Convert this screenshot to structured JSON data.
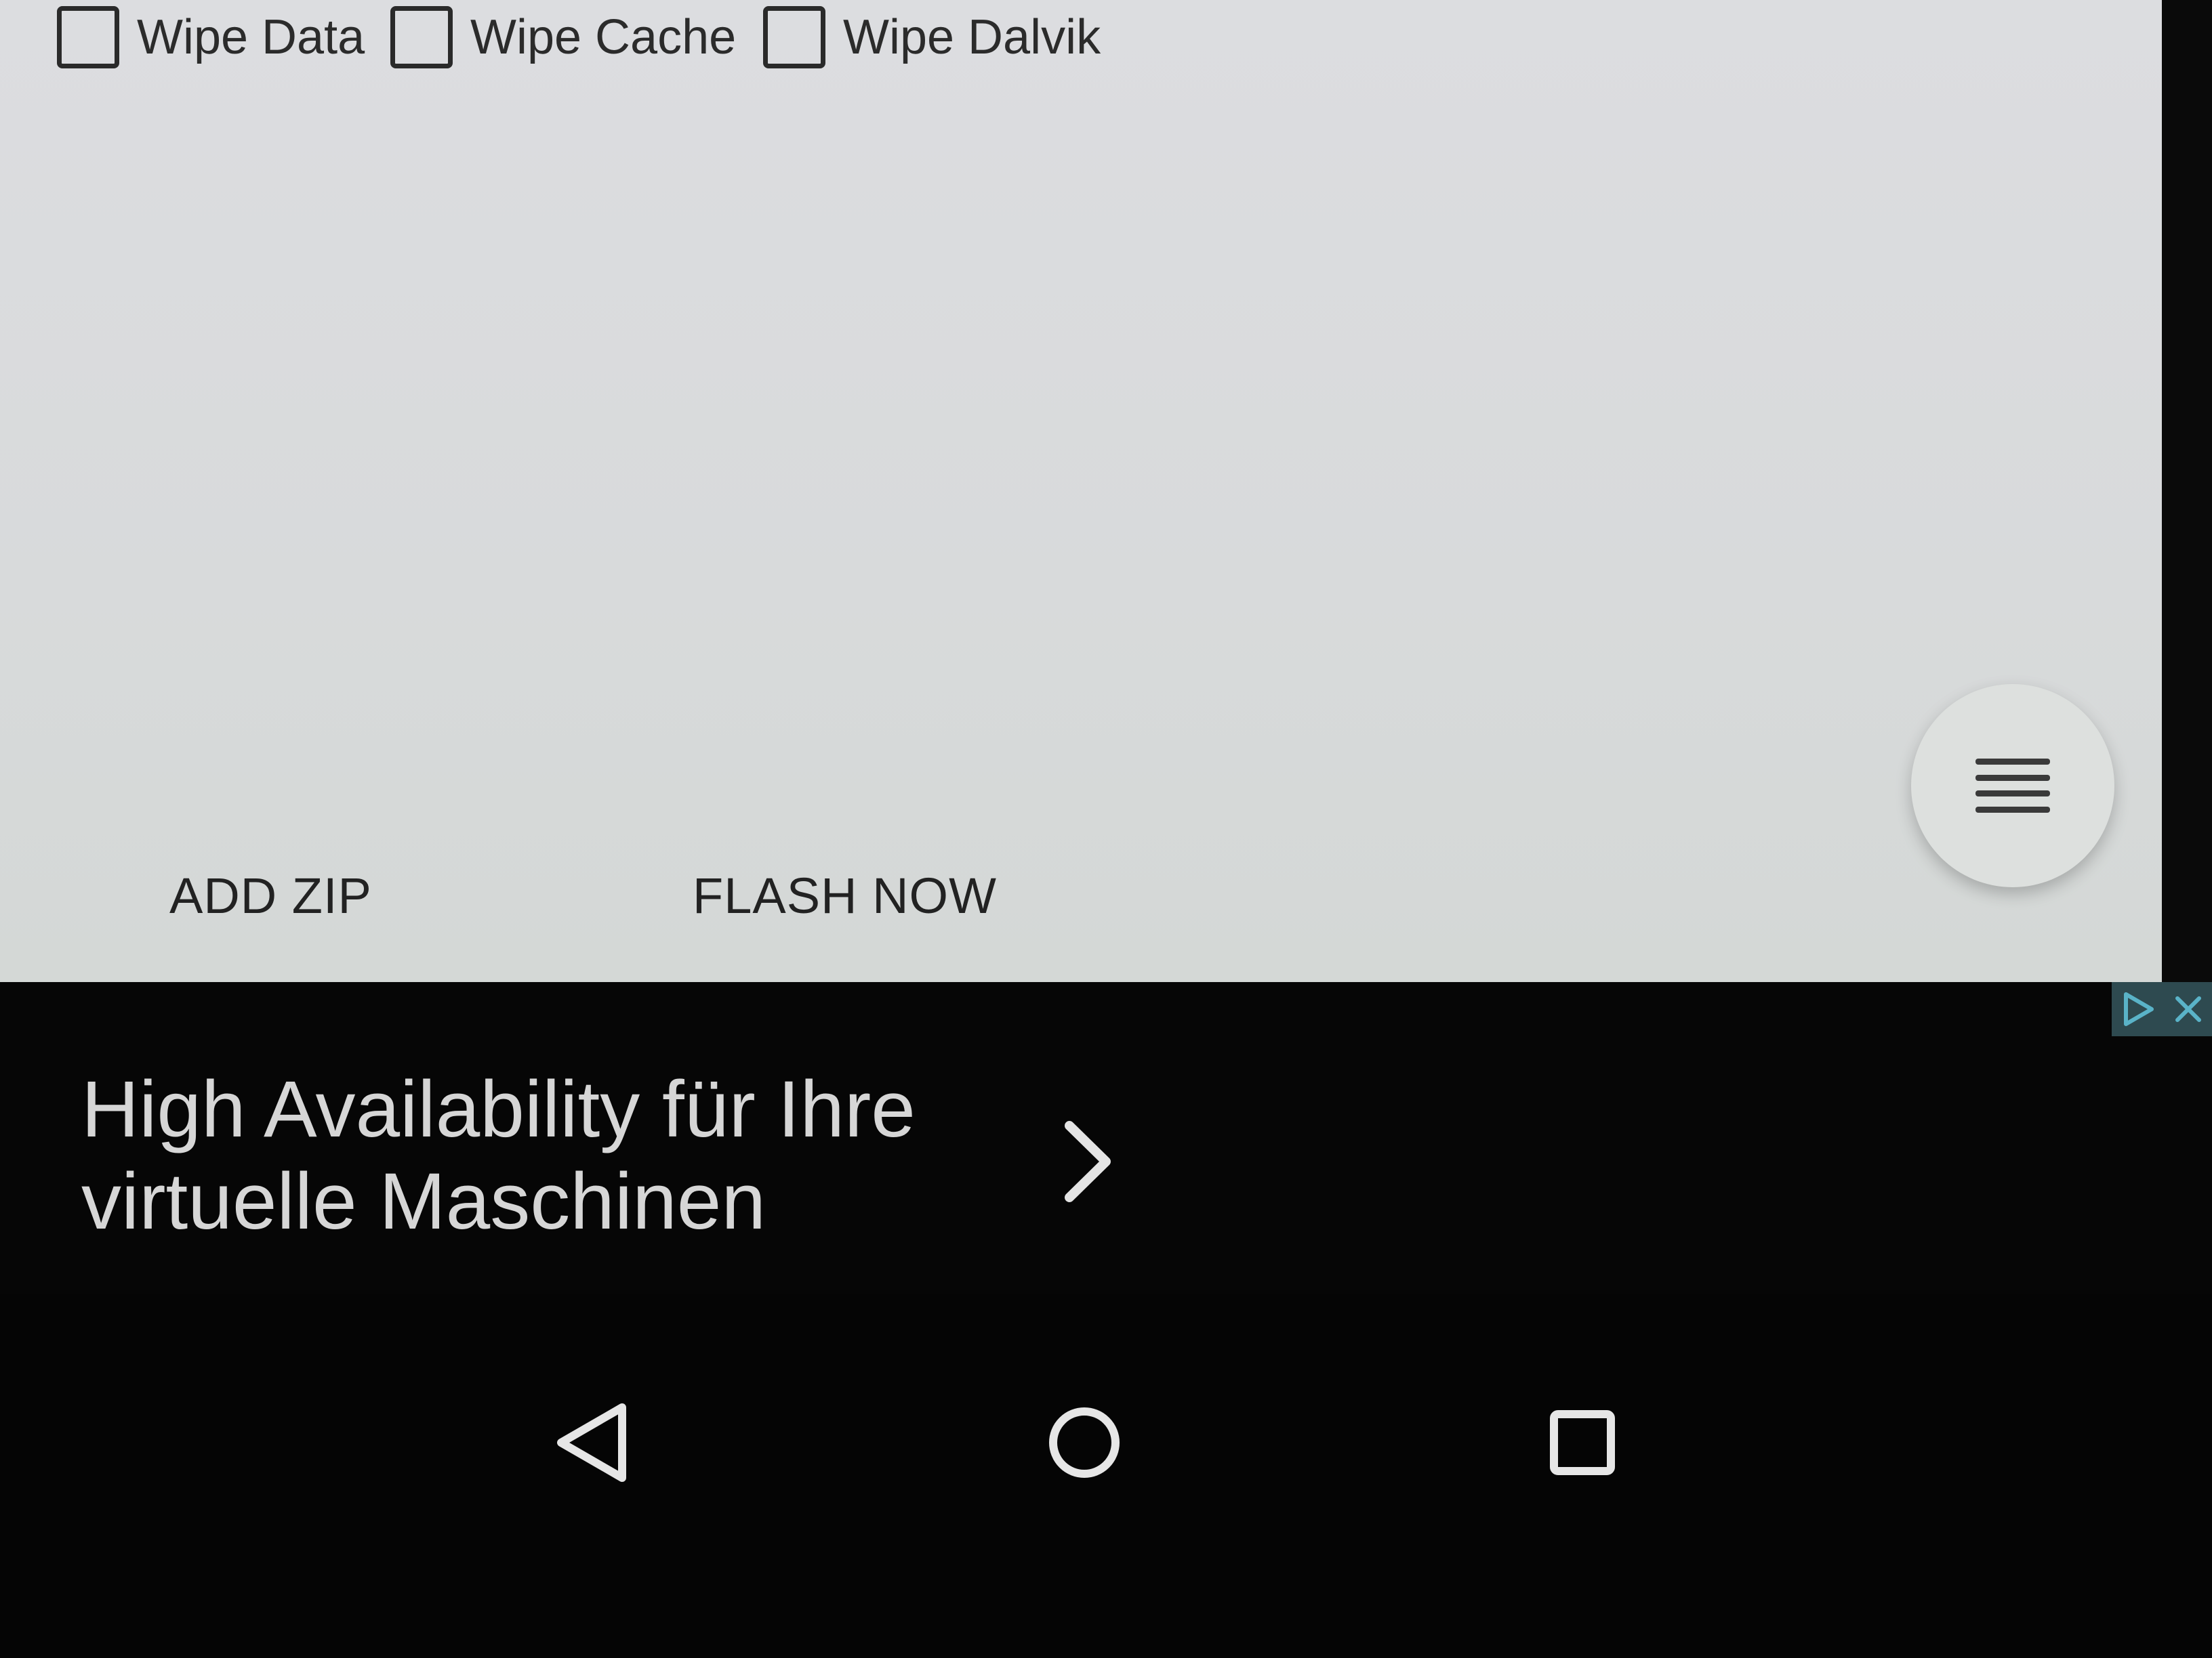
{
  "wipe_options": [
    {
      "label": "Wipe Data",
      "checked": false
    },
    {
      "label": "Wipe Cache",
      "checked": false
    },
    {
      "label": "Wipe Dalvik",
      "checked": false
    }
  ],
  "actions": {
    "add_zip": "ADD ZIP",
    "flash_now": "FLASH NOW"
  },
  "fab": {
    "icon": "menu-icon"
  },
  "ad": {
    "text_line1": "High Availability für Ihre",
    "text_line2": "virtuelle Maschinen",
    "chevron_icon": "chevron-right-icon",
    "badge_icons": [
      "adchoices-icon",
      "close-icon"
    ]
  },
  "nav_bar": {
    "icons": [
      "back-icon",
      "home-icon",
      "recents-icon"
    ]
  },
  "colors": {
    "panel_bg": "#dcdde0",
    "ad_bg": "#060606",
    "ad_text": "#d6d6d6",
    "nav_bg": "#050505",
    "badge_bg": "#2e4a50"
  }
}
